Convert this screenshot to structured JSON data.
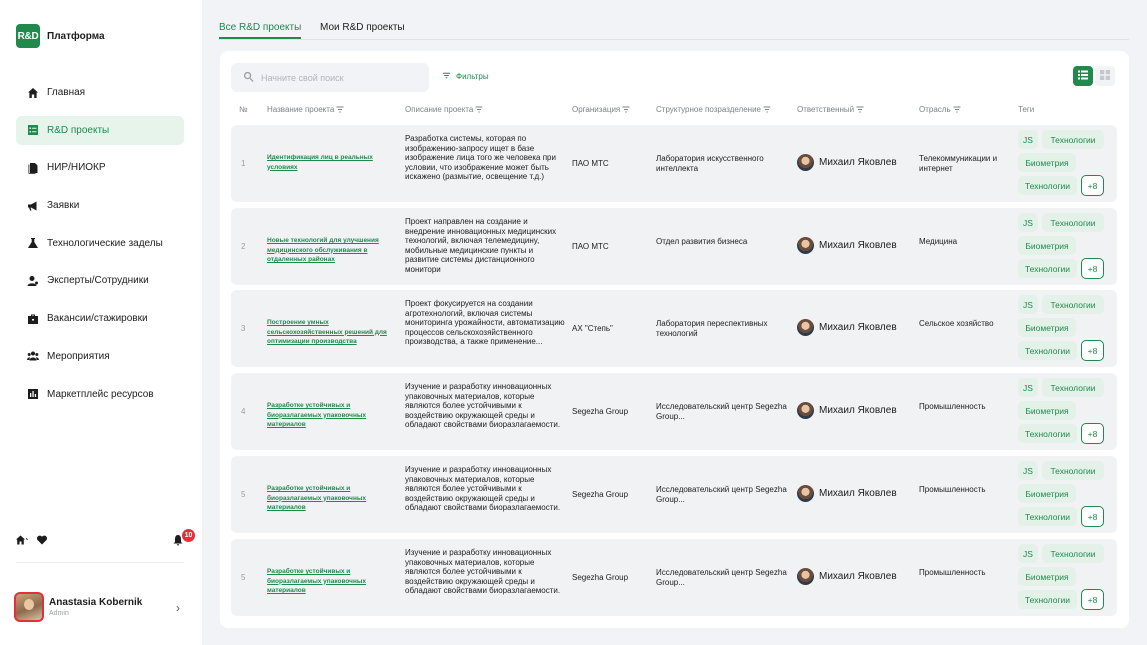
{
  "brand": {
    "logo": "R&D",
    "name": "Платформа"
  },
  "nav": [
    {
      "label": "Главная",
      "icon": "home-icon",
      "active": false
    },
    {
      "label": "R&D проекты",
      "icon": "projects-icon",
      "active": true
    },
    {
      "label": "НИР/НИОКР",
      "icon": "documents-icon",
      "active": false
    },
    {
      "label": "Заявки",
      "icon": "megaphone-icon",
      "active": false
    },
    {
      "label": "Технологические заделы",
      "icon": "flask-icon",
      "active": false
    },
    {
      "label": "Эксперты/Сотрудники",
      "icon": "expert-icon",
      "active": false
    },
    {
      "label": "Вакансии/стажировки",
      "icon": "briefcase-icon",
      "active": false
    },
    {
      "label": "Мероприятия",
      "icon": "people-icon",
      "active": false
    },
    {
      "label": "Маркетплейс ресурсов",
      "icon": "chart-icon",
      "active": false
    }
  ],
  "notifications": {
    "count": "10"
  },
  "user": {
    "name": "Anastasia Kobernik",
    "role": "Admin"
  },
  "tabs": [
    {
      "label": "Все R&D проекты",
      "active": true
    },
    {
      "label": "Мои R&D проекты",
      "active": false
    }
  ],
  "search": {
    "placeholder": "Начните свой поиск"
  },
  "filters_label": "Фильтры",
  "columns": {
    "num": "№",
    "name": "Название проекта",
    "desc": "Описание проекта",
    "org": "Организация",
    "dept": "Структурное позразделение",
    "resp": "Ответственный",
    "industry": "Отрасль",
    "tags": "Теги"
  },
  "colors": {
    "accent": "#1f8a4c",
    "badge": "#e5303b"
  },
  "rows": [
    {
      "num": "1",
      "name": "Идентификация лиц в реальных условиях",
      "desc": "Разработка системы, которая по изображению-запросу ищет в базе изображение лица того же человека при условии, что изображение может быть искажено (размытие, освещение т.д.)",
      "org": "ПАО МТС",
      "dept": "Лаборатория искусственного интеллекта",
      "resp": "Михаил Яковлев",
      "industry": "Телекоммуникации и интернет",
      "tags": [
        "JS",
        "Технологии",
        "Биометрия",
        "Технологии",
        "+8"
      ]
    },
    {
      "num": "2",
      "name": "Новые технологий для улучшения медицинского обслуживания в отдаленных районах",
      "desc": "Проект направлен на создание и внедрение инновационных медицинских технологий, включая телемедицину, мобильные медицинские пункты и развитие системы дистанционного монитори",
      "org": "ПАО МТС",
      "dept": "Отдел развития бизнеса",
      "resp": "Михаил Яковлев",
      "industry": "Медицина",
      "tags": [
        "JS",
        "Технологии",
        "Биометрия",
        "Технологии",
        "+8"
      ]
    },
    {
      "num": "3",
      "name": "Построение умных сельскохозяйственных решений для оптимизации производства",
      "desc": "Проект фокусируется на создании агротехнологий, включая системы мониторинга урожайности, автоматизацию процессов сельскохозяйственного производства, а также применение...",
      "org": "АХ \"Степь\"",
      "dept": "Лаборатория переспективных технологий",
      "resp": "Михаил Яковлев",
      "industry": "Сельское хозяйство",
      "tags": [
        "JS",
        "Технологии",
        "Биометрия",
        "Технологии",
        "+8"
      ]
    },
    {
      "num": "4",
      "name": "Разработке устойчивых и биоразлагаемых упаковочных материалов",
      "desc": "Изучение и разработку инновационных упаковочных материалов, которые являются более устойчивыми к воздействию окружающей среды и обладают свойствами биоразлагаемости.",
      "org": "Segezha Group",
      "dept": "Исследовательский центр Segezha Group...",
      "resp": "Михаил Яковлев",
      "industry": "Промышленность",
      "tags": [
        "JS",
        "Технологии",
        "Биометрия",
        "Технологии",
        "+8"
      ]
    },
    {
      "num": "5",
      "name": "Разработке устойчивых и биоразлагаемых упаковочных материалов",
      "desc": "Изучение и разработку инновационных упаковочных материалов, которые являются более устойчивыми к воздействию окружающей среды и обладают свойствами биоразлагаемости.",
      "org": "Segezha Group",
      "dept": "Исследовательский центр Segezha Group...",
      "resp": "Михаил Яковлев",
      "industry": "Промышленность",
      "tags": [
        "JS",
        "Технологии",
        "Биометрия",
        "Технологии",
        "+8"
      ]
    },
    {
      "num": "5",
      "name": "Разработке устойчивых и биоразлагаемых упаковочных материалов",
      "desc": "Изучение и разработку инновационных упаковочных материалов, которые являются более устойчивыми к воздействию окружающей среды и обладают свойствами биоразлагаемости.",
      "org": "Segezha Group",
      "dept": "Исследовательский центр Segezha Group...",
      "resp": "Михаил Яковлев",
      "industry": "Промышленность",
      "tags": [
        "JS",
        "Технологии",
        "Биометрия",
        "Технологии",
        "+8"
      ]
    }
  ]
}
